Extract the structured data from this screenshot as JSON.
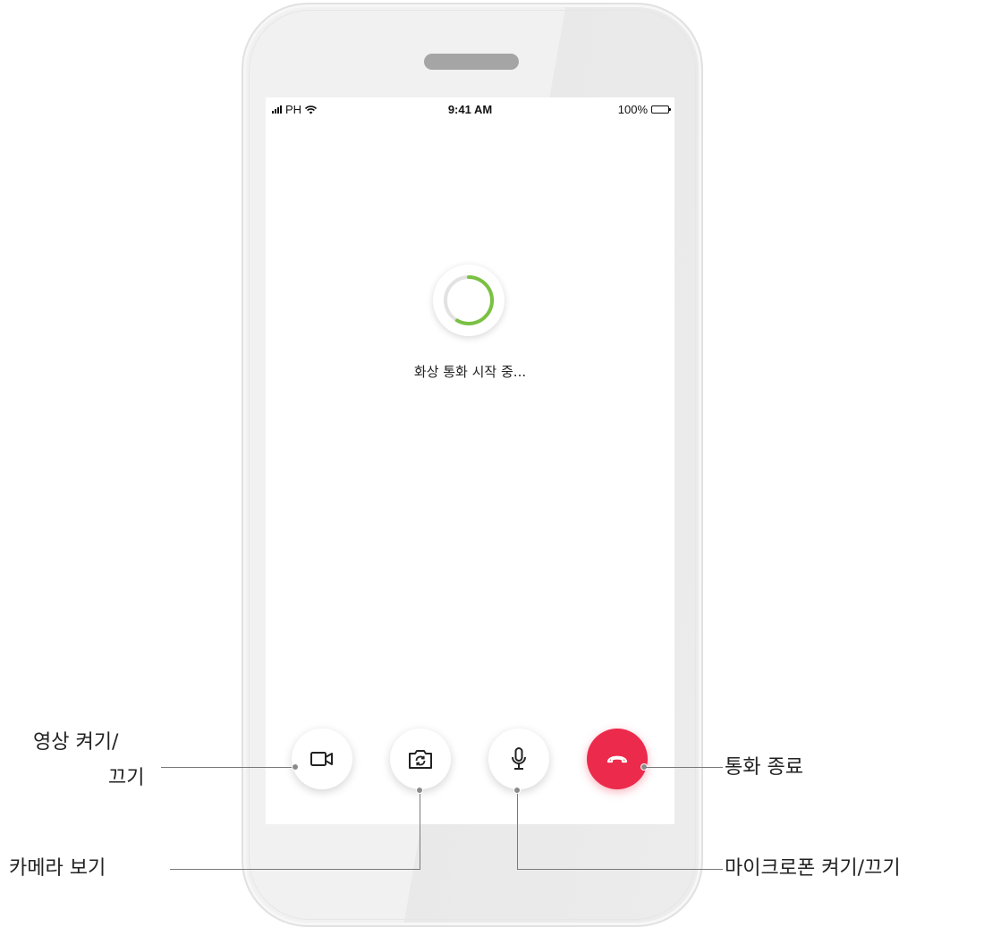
{
  "status_bar": {
    "carrier": "PH",
    "time": "9:41 AM",
    "battery": "100%"
  },
  "call": {
    "status_text": "화상 통화 시작 중..."
  },
  "controls": {
    "video": {
      "icon": "video-camera-icon"
    },
    "camera_switch": {
      "icon": "camera-switch-icon"
    },
    "microphone": {
      "icon": "microphone-icon"
    },
    "end_call": {
      "icon": "hang-up-icon",
      "color": "#ec2a4b"
    }
  },
  "callouts": {
    "video_line1": "영상 켜기/",
    "video_line2": "끄기",
    "camera_view": "카메라 보기",
    "end_call": "통화 종료",
    "microphone": "마이크로폰 켜기/끄기"
  },
  "colors": {
    "spinner_accent": "#7ac143",
    "end_call_red": "#ec2a4b"
  }
}
